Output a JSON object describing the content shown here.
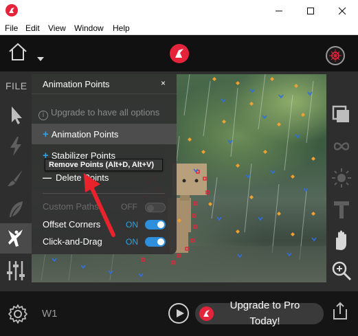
{
  "menubar": {
    "items": [
      "File",
      "Edit",
      "View",
      "Window",
      "Help"
    ]
  },
  "left_rail": {
    "file_label": "FILE"
  },
  "panel": {
    "title": "Animation Points",
    "close": "×",
    "upgrade_notice": "Upgrade to have all options",
    "items": [
      {
        "label": "Animation Points",
        "marker": "+"
      },
      {
        "label": "Stabilizer Points",
        "marker": "+"
      },
      {
        "label": "Delete Points",
        "marker": "—"
      }
    ],
    "toggles": [
      {
        "label": "Custom Paths",
        "state": "OFF",
        "enabled": false
      },
      {
        "label": "Offset Corners",
        "state": "ON",
        "enabled": true
      },
      {
        "label": "Click-and-Drag",
        "state": "ON",
        "enabled": true
      }
    ]
  },
  "tooltip": {
    "text": "Remove Points (Alt+D, Alt+V)"
  },
  "bottombar": {
    "workspace_label": "W1",
    "upgrade_line1": "Upgrade to Pro",
    "upgrade_line2": "Today!"
  },
  "colors": {
    "accent": "#2ea3e6",
    "brand": "#e5243c",
    "annotation_arrow": "#e8232c"
  }
}
